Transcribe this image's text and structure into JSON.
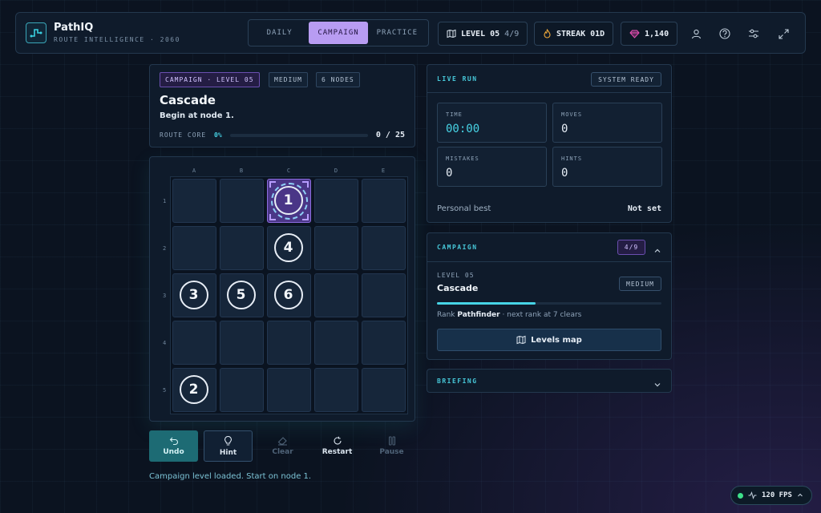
{
  "brand": {
    "name": "PathIQ",
    "subtitle": "ROUTE INTELLIGENCE · 2060"
  },
  "modes": [
    {
      "label": "DAILY",
      "active": false
    },
    {
      "label": "CAMPAIGN",
      "active": true
    },
    {
      "label": "PRACTICE",
      "active": false
    }
  ],
  "header": {
    "level_label": "LEVEL 05",
    "level_progress": "4/9",
    "streak_label": "STREAK 01D",
    "gems": "1,140"
  },
  "level_card": {
    "tags": [
      "CAMPAIGN · LEVEL 05",
      "MEDIUM",
      "6 NODES"
    ],
    "title": "Cascade",
    "instruction": "Begin at node 1.",
    "core_label": "ROUTE CORE",
    "core_pct": "0%",
    "core_progress": 0,
    "core_count": "0 / 25"
  },
  "board": {
    "columns": [
      "A",
      "B",
      "C",
      "D",
      "E"
    ],
    "rows": [
      "1",
      "2",
      "3",
      "4",
      "5"
    ],
    "nodes": [
      {
        "label": "1",
        "row": 0,
        "col": 2,
        "start": true
      },
      {
        "label": "4",
        "row": 1,
        "col": 2
      },
      {
        "label": "3",
        "row": 2,
        "col": 0
      },
      {
        "label": "5",
        "row": 2,
        "col": 1
      },
      {
        "label": "6",
        "row": 2,
        "col": 2
      },
      {
        "label": "2",
        "row": 4,
        "col": 0
      }
    ]
  },
  "toolbar": {
    "undo": "Undo",
    "hint": "Hint",
    "clear": "Clear",
    "restart": "Restart",
    "pause": "Pause"
  },
  "status_message": "Campaign level loaded. Start on node 1.",
  "live_run": {
    "title": "LIVE RUN",
    "badge": "SYSTEM READY",
    "time_label": "TIME",
    "time_value": "00:00",
    "moves_label": "MOVES",
    "moves_value": "0",
    "mistakes_label": "MISTAKES",
    "mistakes_value": "0",
    "hints_label": "HINTS",
    "hints_value": "0",
    "best_label": "Personal best",
    "best_value": "Not set"
  },
  "campaign": {
    "title": "CAMPAIGN",
    "progress_badge": "4/9",
    "level_label": "LEVEL 05",
    "level_name": "Cascade",
    "difficulty": "MEDIUM",
    "progress": 0.44,
    "rank_prefix": "Rank",
    "rank_name": "Pathfinder",
    "rank_suffix": "· next rank at 7 clears",
    "levels_map_label": "Levels map"
  },
  "briefing": {
    "title": "BRIEFING"
  },
  "fps": "120 FPS",
  "colors": {
    "accent_cyan": "#47d4e6",
    "accent_purple": "#b89cf2",
    "gem_pink": "#e84fb5",
    "flame_orange": "#f0a93a",
    "fps_green": "#3ee08a"
  }
}
